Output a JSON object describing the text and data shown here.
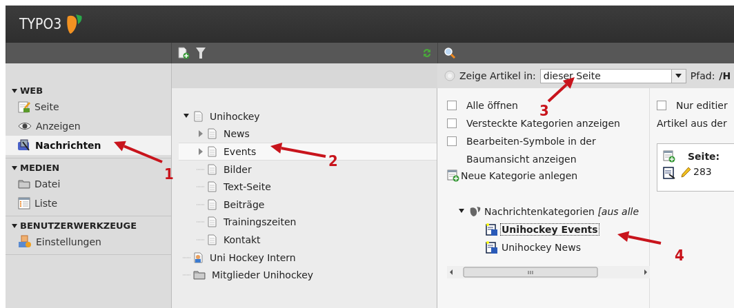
{
  "header": {
    "logo": "TYPO3"
  },
  "sidebar": {
    "groups": [
      {
        "title": "WEB",
        "expanded": true,
        "items": [
          {
            "label": "Seite",
            "kind": "page-edit",
            "selected": false
          },
          {
            "label": "Anzeigen",
            "kind": "eye",
            "selected": false
          },
          {
            "label": "Nachrichten",
            "kind": "news",
            "selected": true
          }
        ]
      },
      {
        "title": "MEDIEN",
        "expanded": true,
        "items": [
          {
            "label": "Datei",
            "kind": "folder",
            "selected": false
          },
          {
            "label": "Liste",
            "kind": "list",
            "selected": false
          }
        ]
      },
      {
        "title": "BENUTZERWERKZEUGE",
        "expanded": true,
        "items": [
          {
            "label": "Einstellungen",
            "kind": "user-settings",
            "selected": false
          }
        ]
      }
    ]
  },
  "page_tree": {
    "nodes": [
      {
        "label": "Unihockey",
        "kind": "page",
        "expanded": true,
        "selected": false,
        "children": [
          {
            "label": "News",
            "kind": "page",
            "expanded": false,
            "selected": false
          },
          {
            "label": "Events",
            "kind": "page",
            "expanded": false,
            "selected": true
          },
          {
            "label": "Bilder",
            "kind": "page",
            "selected": false
          },
          {
            "label": "Text-Seite",
            "kind": "page",
            "selected": false
          },
          {
            "label": "Beiträge",
            "kind": "page",
            "selected": false
          },
          {
            "label": "Trainingszeiten",
            "kind": "page",
            "selected": false
          },
          {
            "label": "Kontakt",
            "kind": "page",
            "selected": false
          }
        ]
      },
      {
        "label": "Uni Hockey Intern",
        "kind": "user-page",
        "selected": false
      },
      {
        "label": "Mitglieder Unihockey",
        "kind": "folder",
        "selected": false
      }
    ]
  },
  "news_module": {
    "filter": {
      "label": "Zeige Artikel in:",
      "value": "dieser Seite"
    },
    "path": {
      "label": "Pfad:",
      "value": "/H"
    },
    "options": [
      {
        "label": "Alle öffnen",
        "checked": false
      },
      {
        "label": "Versteckte Kategorien anzeigen",
        "checked": false
      },
      {
        "label": "Bearbeiten-Symbole in der Baumansicht anzeigen",
        "checked": false
      }
    ],
    "new_category": "Neue Kategorie anlegen",
    "category_tree": {
      "label": "Nachrichtenkategorien *[aus alle*",
      "expanded": true,
      "children": [
        {
          "label": "Unihockey Events",
          "selected": true
        },
        {
          "label": "Unihockey News",
          "selected": false
        }
      ]
    },
    "only_editable": {
      "label": "Nur editier",
      "checked": false
    },
    "articles_from": "Artikel aus der",
    "article_table": {
      "column": "Seite:",
      "rows": [
        {
          "page": "283"
        }
      ]
    }
  },
  "annotations": [
    {
      "number": "1"
    },
    {
      "number": "2"
    },
    {
      "number": "3"
    },
    {
      "number": "4"
    }
  ]
}
